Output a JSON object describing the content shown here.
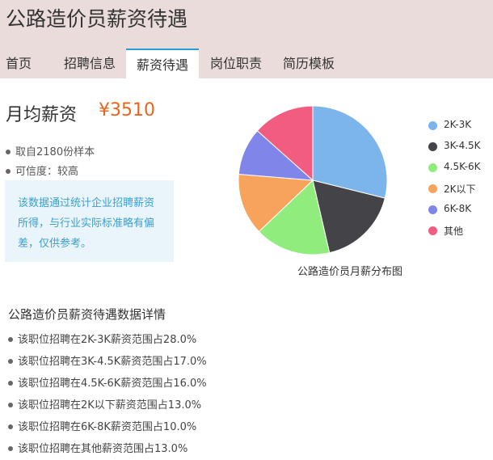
{
  "header": {
    "title": "公路造价员薪资待遇",
    "tabs": [
      {
        "label": "首页",
        "active": false
      },
      {
        "label": "招聘信息",
        "active": false
      },
      {
        "label": "薪资待遇",
        "active": true
      },
      {
        "label": "岗位职责",
        "active": false
      },
      {
        "label": "简历模板",
        "active": false
      }
    ]
  },
  "salary": {
    "label": "月均薪资",
    "value": "¥3510",
    "sample": "取自2180份样本",
    "credibility": "可信度：较高",
    "notice": "该数据通过统计企业招聘薪资所得，与行业实际标准略有偏差，仅供参考。"
  },
  "chart_data": {
    "type": "pie",
    "title": "公路造价员月薪分布图",
    "categories": [
      "2K-3K",
      "3K-4.5K",
      "4.5K-6K",
      "2K以下",
      "6K-8K",
      "其他"
    ],
    "values": [
      28.0,
      17.0,
      16.0,
      13.0,
      10.0,
      13.0
    ],
    "colors": [
      "#7cb5ec",
      "#434348",
      "#90ed7d",
      "#f7a35c",
      "#8085e9",
      "#f15c80"
    ],
    "legend_position": "right"
  },
  "details": {
    "title": "公路造价员薪资待遇数据详情",
    "items": [
      "该职位招聘在2K-3K薪资范围占28.0%",
      "该职位招聘在3K-4.5K薪资范围占17.0%",
      "该职位招聘在4.5K-6K薪资范围占16.0%",
      "该职位招聘在2K以下薪资范围占13.0%",
      "该职位招聘在6K-8K薪资范围占10.0%",
      "该职位招聘在其他薪资范围占13.0%"
    ]
  }
}
